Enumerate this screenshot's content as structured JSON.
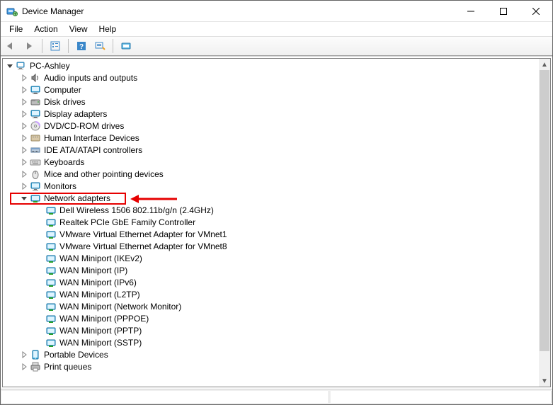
{
  "window": {
    "title": "Device Manager"
  },
  "menu": {
    "file": "File",
    "action": "Action",
    "view": "View",
    "help": "Help"
  },
  "tree": {
    "root": {
      "label": "PC-Ashley",
      "expanded": true
    },
    "cats": [
      {
        "label": "Audio inputs and outputs",
        "icon": "speaker",
        "expanded": false
      },
      {
        "label": "Computer",
        "icon": "monitor",
        "expanded": false
      },
      {
        "label": "Disk drives",
        "icon": "disk",
        "expanded": false
      },
      {
        "label": "Display adapters",
        "icon": "monitor",
        "expanded": false
      },
      {
        "label": "DVD/CD-ROM drives",
        "icon": "disc",
        "expanded": false
      },
      {
        "label": "Human Interface Devices",
        "icon": "hid",
        "expanded": false
      },
      {
        "label": "IDE ATA/ATAPI controllers",
        "icon": "ide",
        "expanded": false
      },
      {
        "label": "Keyboards",
        "icon": "keyboard",
        "expanded": false
      },
      {
        "label": "Mice and other pointing devices",
        "icon": "mouse",
        "expanded": false
      },
      {
        "label": "Monitors",
        "icon": "monitor",
        "expanded": false
      },
      {
        "label": "Network adapters",
        "icon": "nic",
        "expanded": true,
        "children": [
          {
            "label": "Dell Wireless 1506 802.11b/g/n (2.4GHz)"
          },
          {
            "label": "Realtek PCIe GbE Family Controller"
          },
          {
            "label": "VMware Virtual Ethernet Adapter for VMnet1"
          },
          {
            "label": "VMware Virtual Ethernet Adapter for VMnet8"
          },
          {
            "label": "WAN Miniport (IKEv2)"
          },
          {
            "label": "WAN Miniport (IP)"
          },
          {
            "label": "WAN Miniport (IPv6)"
          },
          {
            "label": "WAN Miniport (L2TP)"
          },
          {
            "label": "WAN Miniport (Network Monitor)"
          },
          {
            "label": "WAN Miniport (PPPOE)"
          },
          {
            "label": "WAN Miniport (PPTP)"
          },
          {
            "label": "WAN Miniport (SSTP)"
          }
        ]
      },
      {
        "label": "Portable Devices",
        "icon": "portable",
        "expanded": false
      },
      {
        "label": "Print queues",
        "icon": "printer",
        "expanded": false
      }
    ]
  }
}
